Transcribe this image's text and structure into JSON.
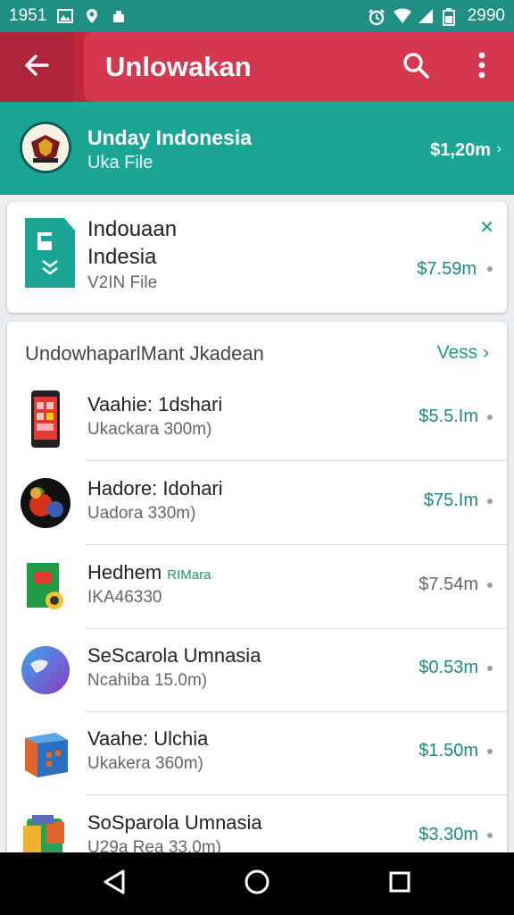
{
  "status_bar": {
    "time": "1951",
    "battery_text": "2990",
    "left_icons": [
      "gallery-icon",
      "location-pin-icon",
      "android-debug-icon"
    ],
    "right_icons": [
      "alarm-icon",
      "wifi-icon",
      "cell-signal-icon",
      "battery-icon"
    ]
  },
  "app_bar": {
    "title": "Unlowakan",
    "back_icon": "arrow-back-icon",
    "search_icon": "search-icon",
    "more_icon": "more-vert-icon"
  },
  "banner": {
    "name": "Unday  Indonesia",
    "subtitle": "Uka File",
    "price": "$1,20m"
  },
  "feature_card": {
    "title_line1": "Indouaan",
    "title_line2": "Indesia",
    "subtitle": "V2IN File",
    "price": "$7.59m"
  },
  "list": {
    "header_title": "UndowhaparlMant Jkadean",
    "header_action": "Vess",
    "items": [
      {
        "name": "Vaahie: 1dshari",
        "tag": "",
        "sub": "Ukackara 300m)",
        "price": "$5.5.Im",
        "icon": "phone-icon"
      },
      {
        "name": "Hadore: Idohari",
        "tag": "",
        "sub": "Uadora 330m)",
        "price": "$75.Im",
        "icon": "fruit-icon"
      },
      {
        "name": "Hedhem",
        "tag": "RIMara",
        "sub": "IKA46330",
        "price": "$7.54m",
        "icon": "document-icon"
      },
      {
        "name": "SeScarola Umnasia",
        "tag": "",
        "sub": "Ncahiba 15.0m)",
        "price": "$0.53m",
        "icon": "globe-icon"
      },
      {
        "name": "Vaahe: Ulchia",
        "tag": "",
        "sub": "Ukakera 360m)",
        "price": "$1.50m",
        "icon": "cube-icon"
      },
      {
        "name": "SoSparola Umnasia",
        "tag": "",
        "sub": "U29a Rea 33.0m)",
        "price": "$3.30m",
        "icon": "box-icon"
      }
    ]
  },
  "nav_bar": {
    "back": "nav-back-icon",
    "home": "nav-home-icon",
    "recents": "nav-recents-icon"
  },
  "colors": {
    "status_bar": "#1e8f82",
    "app_bar": "#c0283f",
    "banner": "#1ba595",
    "accent": "#1b9e8f",
    "price": "#1b8a7e"
  }
}
